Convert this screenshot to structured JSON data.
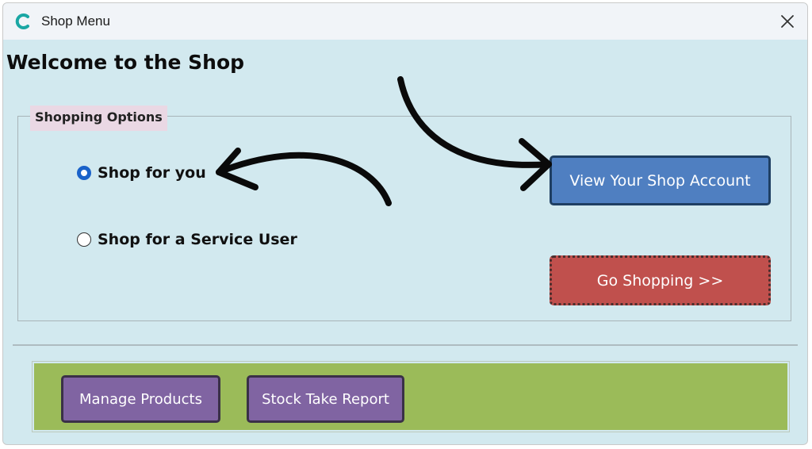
{
  "window": {
    "title": "Shop Menu",
    "app_icon": "app-c-icon",
    "close_icon": "close-icon"
  },
  "heading": "Welcome to the Shop",
  "shopping_options": {
    "legend": "Shopping Options",
    "radios": [
      {
        "label": "Shop for you",
        "checked": true
      },
      {
        "label": "Shop for a Service User",
        "checked": false
      }
    ]
  },
  "actions": {
    "view_account": "View Your Shop Account",
    "go_shopping": "Go Shopping >>"
  },
  "admin": {
    "manage_products": "Manage Products",
    "stock_take_report": "Stock Take Report"
  },
  "colors": {
    "window_bg": "#d2e9ef",
    "legend_bg": "#ead8e4",
    "view_account_bg": "#4f7fc1",
    "go_shopping_bg": "#c0504d",
    "admin_panel_bg": "#9bbb59",
    "admin_button_bg": "#8064a2",
    "radio_selected": "#1a62c9"
  }
}
